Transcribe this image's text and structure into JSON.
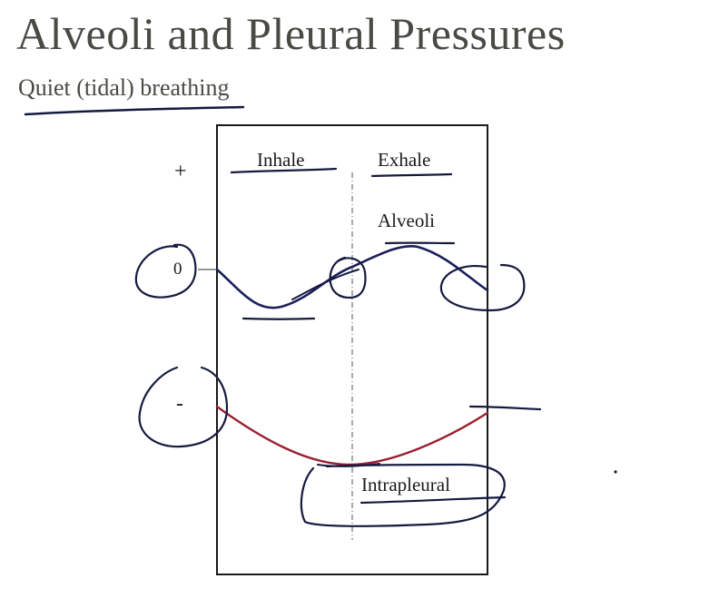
{
  "slide": {
    "title": "Alveoli and Pleural Pressures",
    "subtitle": "Quiet (tidal) breathing"
  },
  "diagram": {
    "plus_label": "+",
    "zero_label": "0",
    "minus_label": "-",
    "inhale_label": "Inhale",
    "exhale_label": "Exhale",
    "alveoli_label": "Alveoli",
    "intrapleural_label": "Intrapleural"
  },
  "colors": {
    "title_text": "#4a4a44",
    "alveoli_curve": "#1b1f5a",
    "intrapleural_curve": "#9a1f30",
    "ink": "#1a1a1a",
    "annotation_ink": "#151a40"
  }
}
